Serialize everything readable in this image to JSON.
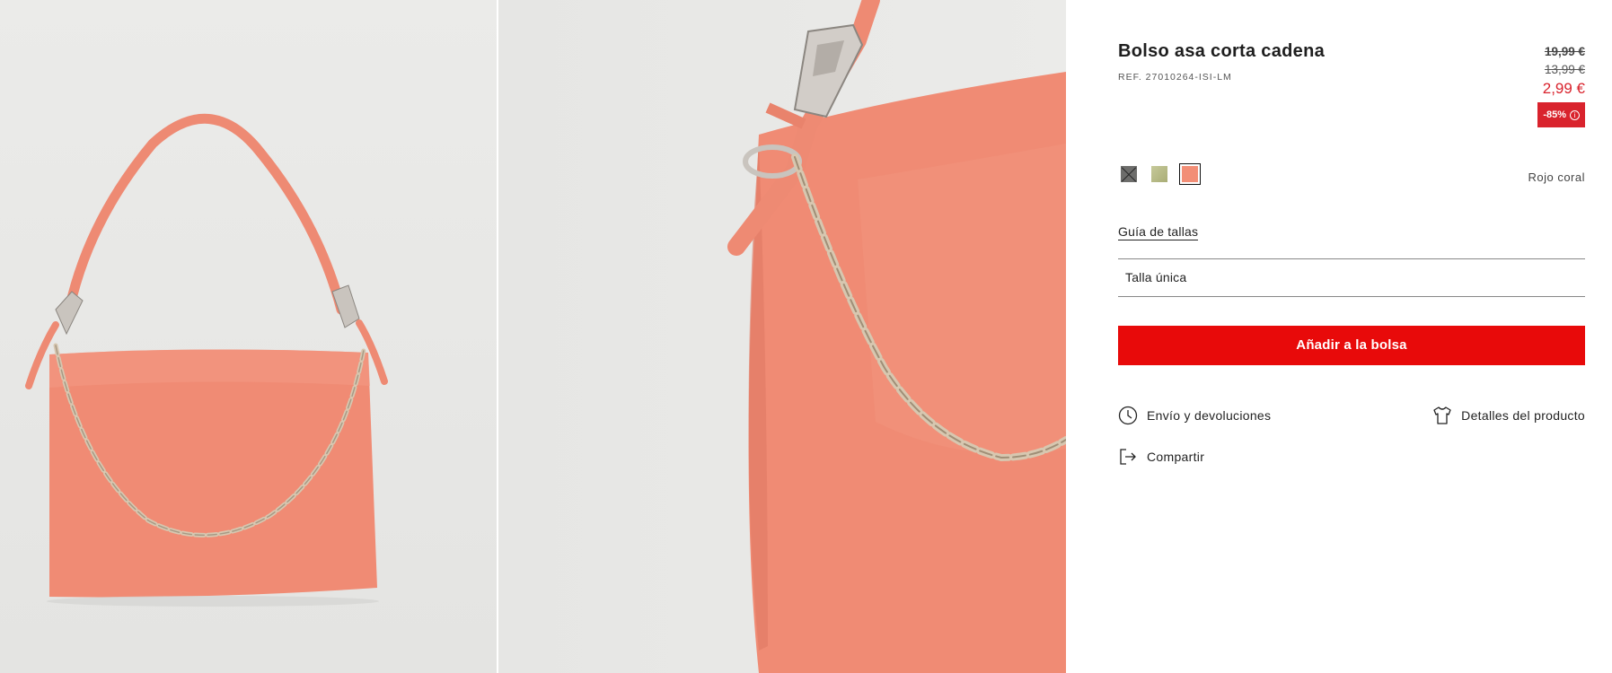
{
  "product": {
    "title": "Bolso asa corta cadena",
    "reference": "REF. 27010264-ISI-LM",
    "old_price_1": "19,99 €",
    "old_price_2": "13,99 €",
    "current_price": "2,99 €",
    "discount": "-85%",
    "discount_info_icon": "info-icon"
  },
  "colors": {
    "options": [
      {
        "name": "grey",
        "swatch": "#6d6d6b",
        "available": false
      },
      {
        "name": "olive",
        "swatch": "#b8bb86",
        "available": true
      },
      {
        "name": "coral",
        "swatch": "#f28e76",
        "available": true,
        "selected": true
      }
    ],
    "selected_name": "Rojo coral"
  },
  "size": {
    "guide_label": "Guía de tallas",
    "selected": "Talla única"
  },
  "cta": {
    "add_to_bag": "Añadir a la bolsa",
    "color": "#e80a0a"
  },
  "actions": {
    "shipping": {
      "label": "Envío y devoluciones",
      "icon": "clock-icon"
    },
    "details": {
      "label": "Detalles del producto",
      "icon": "tshirt-icon"
    },
    "share": {
      "label": "Compartir",
      "icon": "share-icon"
    }
  },
  "accent": {
    "price_red": "#d9232d",
    "bag_coral": "#f28e76"
  }
}
